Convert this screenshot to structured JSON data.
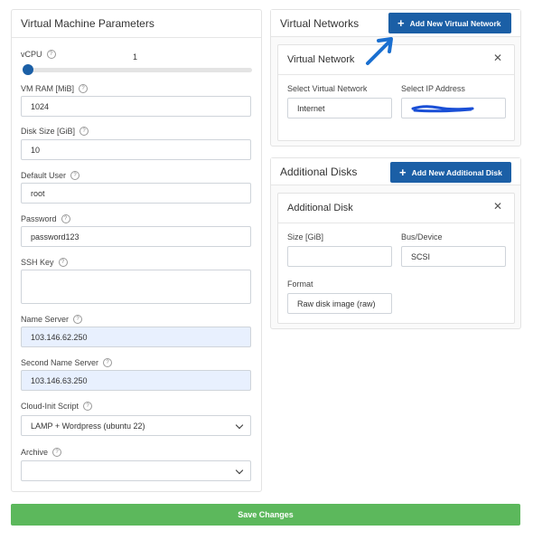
{
  "vm_params": {
    "title": "Virtual Machine Parameters",
    "vcpu_label": "vCPU",
    "vcpu_value": "1",
    "vcpu_level": 0.0,
    "ram_label": "VM RAM [MiB]",
    "ram_value": "1024",
    "disk_label": "Disk Size [GiB]",
    "disk_value": "10",
    "user_label": "Default User",
    "user_value": "root",
    "password_label": "Password",
    "password_value": "password123",
    "ssh_label": "SSH Key",
    "ssh_value": "",
    "ns_label": "Name Server",
    "ns_value": "103.146.62.250",
    "ns2_label": "Second Name Server",
    "ns2_value": "103.146.63.250",
    "cloudinit_label": "Cloud-Init Script",
    "cloudinit_value": "LAMP + Wordpress (ubuntu 22)",
    "archive_label": "Archive",
    "archive_value": ""
  },
  "virtual_networks": {
    "title": "Virtual Networks",
    "add_button": "Add New Virtual Network",
    "item_title": "Virtual Network",
    "select_network_label": "Select Virtual Network",
    "select_network_value": "Internet",
    "select_ip_label": "Select IP Address",
    "select_ip_value": ""
  },
  "additional_disks": {
    "title": "Additional Disks",
    "add_button": "Add New Additional Disk",
    "item_title": "Additional Disk",
    "size_label": "Size [GiB]",
    "size_value": "",
    "bus_label": "Bus/Device",
    "bus_value": "SCSI",
    "format_label": "Format",
    "format_value": "Raw disk image (raw)"
  },
  "save_button": "Save Changes",
  "colors": {
    "primary": "#1b5fa6",
    "save_green": "#5cb85c",
    "autofill_bg": "#e8f0fe"
  }
}
